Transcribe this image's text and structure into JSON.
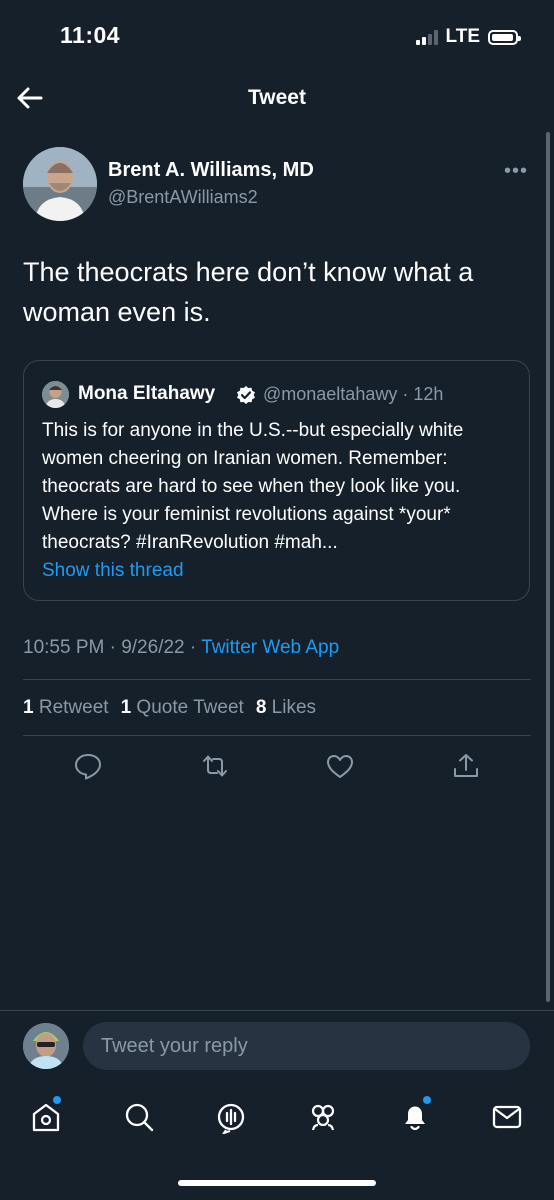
{
  "status_bar": {
    "time": "11:04",
    "network": "LTE"
  },
  "nav": {
    "title": "Tweet"
  },
  "tweet": {
    "author_name": "Brent A. Williams, MD",
    "author_handle": "@BrentAWilliams2",
    "more_label": "•••",
    "text": "The theocrats here don’t know what a woman even is.",
    "quote": {
      "author_name": "Mona Eltahawy",
      "author_handle": "@monaeltahawy · 12h",
      "text": "This is for anyone in the U.S.--but especially white women cheering on Iranian women. Remember: theocrats are hard to see when they look like you. Where is your feminist revolutions against *your* theocrats? #IranRevolution #mah...",
      "show_thread": "Show this thread"
    },
    "timestamp": "10:55 PM · 9/26/22 · ",
    "source": "Twitter Web App",
    "stats": {
      "retweets_count": "1",
      "retweets_label": "Retweet",
      "quotes_count": "1",
      "quotes_label": "Quote Tweet",
      "likes_count": "8",
      "likes_label": "Likes"
    }
  },
  "reply": {
    "placeholder": "Tweet your reply"
  },
  "tab_bar": {
    "items": [
      "home-icon",
      "search-icon",
      "spaces-icon",
      "communities-icon",
      "notifications-icon",
      "messages-icon"
    ]
  },
  "colors": {
    "background": "#15202b",
    "accent": "#1d9bf0",
    "muted": "#8b98a5",
    "border": "#38444d"
  }
}
